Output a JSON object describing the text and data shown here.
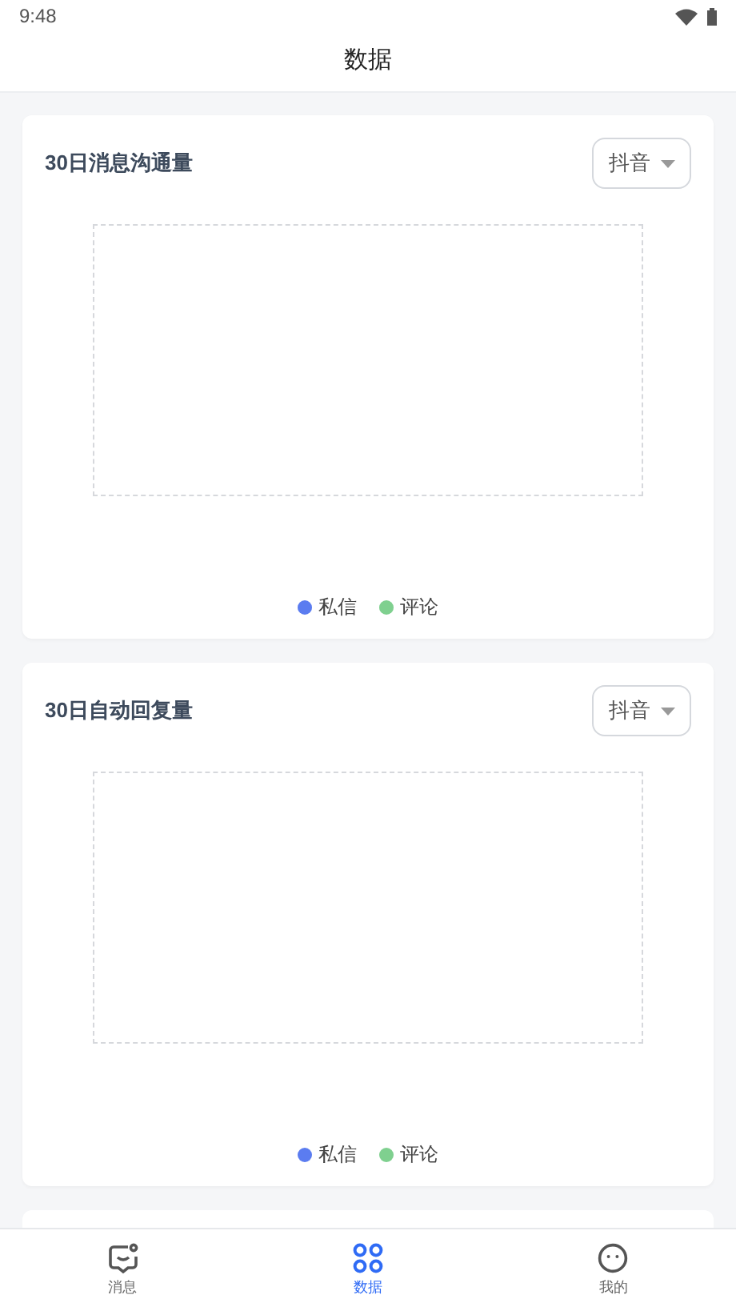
{
  "status_bar": {
    "time": "9:48"
  },
  "header": {
    "title": "数据"
  },
  "cards": [
    {
      "title": "30日消息沟通量",
      "dropdown": {
        "value": "抖音"
      },
      "legend": [
        {
          "label": "私信",
          "color": "#5b7cf0"
        },
        {
          "label": "评论",
          "color": "#7fd08f"
        }
      ]
    },
    {
      "title": "30日自动回复量",
      "dropdown": {
        "value": "抖音"
      },
      "legend": [
        {
          "label": "私信",
          "color": "#5b7cf0"
        },
        {
          "label": "评论",
          "color": "#7fd08f"
        }
      ]
    }
  ],
  "tab_bar": [
    {
      "kind": "message",
      "label": "消息",
      "selected": false
    },
    {
      "kind": "grid",
      "label": "数据",
      "selected": true
    },
    {
      "kind": "face",
      "label": "我的",
      "selected": false
    }
  ]
}
